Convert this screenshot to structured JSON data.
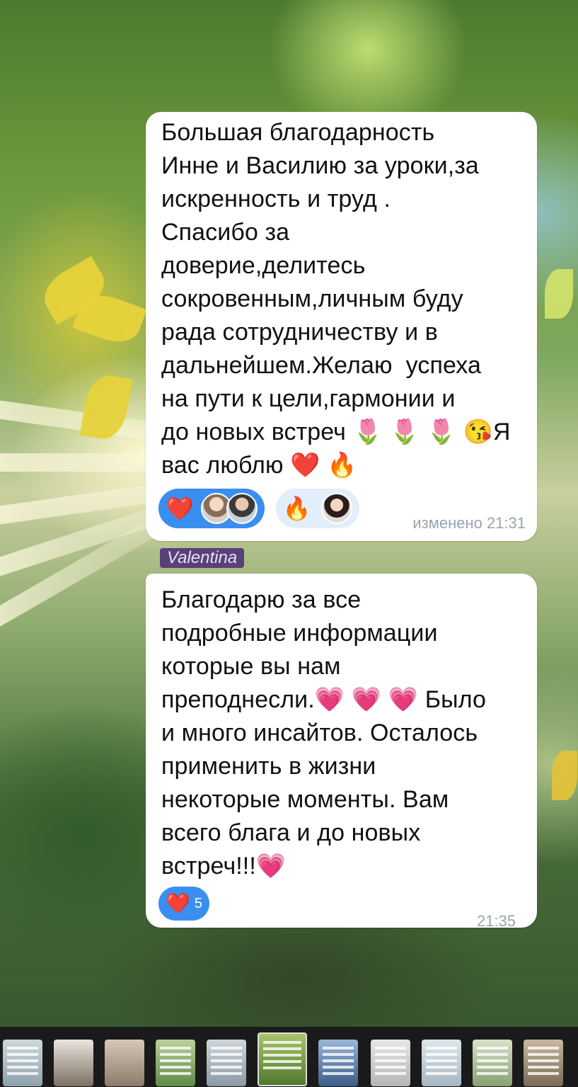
{
  "messages": [
    {
      "text": "Большая благодарность\nИнне и Василию за уроки,за\nискренность и труд .\nСпасибо за\nдоверие,делитесь\nсокровенным,личным буду\nрада сотрудничеству и в\nдальнейшем.Желаю  успеха\nна пути к цели,гармонии и\nдо новых встреч 🌷 🌷 🌷 😘Я\nвас люблю ❤️ 🔥",
      "reactions": [
        {
          "emoji": "❤️",
          "avatars": [
            "avatar-1",
            "avatar-2"
          ]
        },
        {
          "emoji": "🔥",
          "avatars": [
            "avatar-3"
          ]
        }
      ],
      "time": "изменено 21:31"
    },
    {
      "author": "Valentina",
      "text": "Благодарю за все\nподробные информации\nкоторые вы нам\nпреподнесли.💗 💗 💗 Было\nи много инсайтов. Осталось\nприменить в жизни\nнекоторые моменты. Вам\nвсего блага и до новых\nвстреч!!!💗",
      "reactions": [
        {
          "emoji": "❤️",
          "count": "5"
        }
      ],
      "time": "21:35"
    }
  ],
  "thumbnails_count": 11,
  "colors": {
    "reaction_blue": "#3a8ef0",
    "reaction_light": "#e3eefb",
    "timestamp": "#9aa3ad",
    "author_badge": "#5a3f78"
  }
}
